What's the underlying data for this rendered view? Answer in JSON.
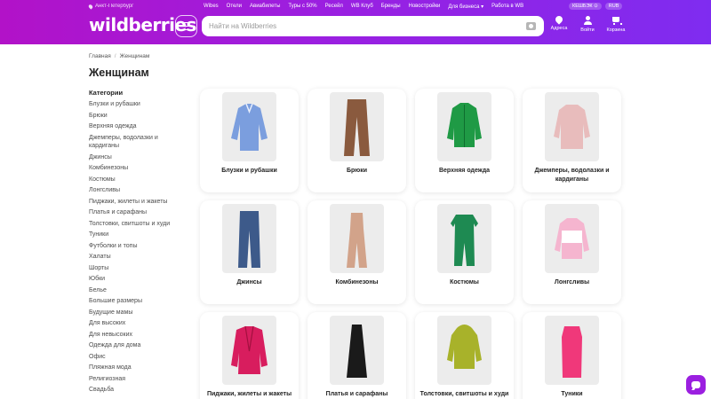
{
  "header": {
    "location": "Анкт-Петербург",
    "nav": [
      "Wibes",
      "Отели",
      "Авиабилеты",
      "Туры с 50%",
      "Ресейл",
      "WB Клуб",
      "Бренды",
      "Новостройки",
      "Для бизнеса ▾",
      "Работа в WB"
    ],
    "badges": [
      "КЕШБЭК ⊙",
      "RUB"
    ],
    "logo": "wildberries",
    "search_placeholder": "Найти на Wildberries",
    "icons": [
      {
        "label": "Адреса",
        "icon": "location-pin-icon"
      },
      {
        "label": "Войти",
        "icon": "user-icon"
      },
      {
        "label": "Корзина",
        "icon": "cart-icon"
      }
    ],
    "gradient": [
      "#b212c8",
      "#7f2cf0"
    ]
  },
  "breadcrumb": [
    "Главная",
    "Женщинам"
  ],
  "title": "Женщинам",
  "sidebar": {
    "heading": "Категории",
    "items": [
      "Блузки и рубашки",
      "Брюки",
      "Верхняя одежда",
      "Джемперы, водолазки и кардиганы",
      "Джинсы",
      "Комбинезоны",
      "Костюмы",
      "Лонгсливы",
      "Пиджаки, жилеты и жакеты",
      "Платья и сарафаны",
      "Толстовки, свитшоты и худи",
      "Туники",
      "Футболки и топы",
      "Халаты",
      "Шорты",
      "Юбки",
      "Белье",
      "Большие размеры",
      "Будущие мамы",
      "Для высоких",
      "Для невысоких",
      "Одежда для дома",
      "Офис",
      "Пляжная мода",
      "Религиозная",
      "Свадьба"
    ]
  },
  "categories": [
    {
      "label": "Блузки и рубашки",
      "image": "blue-shirt",
      "color": "#7b9ede"
    },
    {
      "label": "Брюки",
      "image": "brown-trousers",
      "color": "#8a5a3e"
    },
    {
      "label": "Верхняя одежда",
      "image": "green-jacket",
      "color": "#1f9a45"
    },
    {
      "label": "Джемперы, водолазки и кардиганы",
      "image": "pink-sweater",
      "color": "#e8bcbc"
    },
    {
      "label": "Джинсы",
      "image": "blue-jeans",
      "color": "#3d5a8a"
    },
    {
      "label": "Комбинезоны",
      "image": "beige-jumpsuit",
      "color": "#d2a38a"
    },
    {
      "label": "Костюмы",
      "image": "green-suit",
      "color": "#1e8a52"
    },
    {
      "label": "Лонгсливы",
      "image": "pink-white-longsleeve",
      "color": "#f5b5cf"
    },
    {
      "label": "Пиджаки, жилеты и жакеты",
      "image": "pink-blazer",
      "color": "#d81d5e"
    },
    {
      "label": "Платья и сарафаны",
      "image": "black-dress",
      "color": "#1a1a1a"
    },
    {
      "label": "Толстовки, свитшоты и худи",
      "image": "olive-hoodie",
      "color": "#a8b22a"
    },
    {
      "label": "Туники",
      "image": "pink-tunic",
      "color": "#f0387a"
    }
  ]
}
